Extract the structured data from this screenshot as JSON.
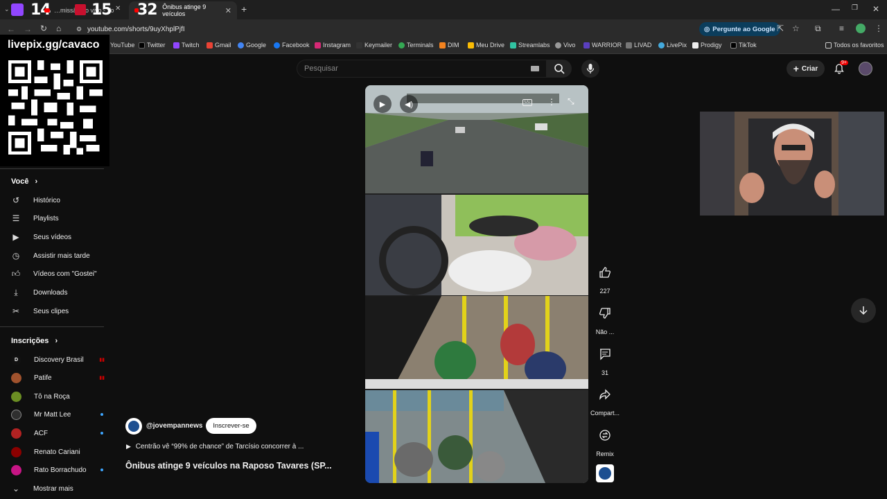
{
  "browser": {
    "tabs": [
      {
        "label": "…missão ao vivo - Yo",
        "counter": "14"
      },
      {
        "label": "",
        "counter": "15"
      },
      {
        "label": "Ônibus atinge 9 veículos",
        "counter": "32"
      }
    ],
    "new_tab": "+",
    "url": "youtube.com/shorts/9uyXhplPjfI",
    "ask_google": "Pergunte ao Google",
    "bookmarks": [
      "YouTube",
      "Twitter",
      "Twitch",
      "Gmail",
      "Google",
      "Facebook",
      "Instagram",
      "Keymailer",
      "Terminals",
      "DIM",
      "Meu Drive",
      "Streamlabs",
      "Vivo",
      "WARRIOR",
      "LIVAD",
      "LivePix",
      "Prodigy",
      "TikTok"
    ],
    "all_bookmarks": "Todos os favoritos"
  },
  "overlay": {
    "livepix": "livepix.gg/cavaco"
  },
  "sidebar": {
    "you_heading": "Você",
    "you_items": [
      {
        "label": "Histórico",
        "icon": "history-icon"
      },
      {
        "label": "Playlists",
        "icon": "playlist-icon"
      },
      {
        "label": "Seus vídeos",
        "icon": "your-videos-icon"
      },
      {
        "label": "Assistir mais tarde",
        "icon": "watch-later-icon"
      },
      {
        "label": "Vídeos com \"Gostei\"",
        "icon": "thumbs-up-icon"
      },
      {
        "label": "Downloads",
        "icon": "download-icon"
      },
      {
        "label": "Seus clipes",
        "icon": "scissors-icon"
      }
    ],
    "subs_heading": "Inscrições",
    "subscriptions": [
      {
        "label": "Discovery Brasil",
        "live": true,
        "color": "#111111",
        "initial": "D"
      },
      {
        "label": "Patife",
        "live": true,
        "color": "#a0522d",
        "initial": ""
      },
      {
        "label": "Tô na Roça",
        "live": false,
        "color": "#6b8e23",
        "initial": ""
      },
      {
        "label": "Mr Matt Lee",
        "live": false,
        "color": "#2f2f2f",
        "initial": ""
      },
      {
        "label": "ACF",
        "live": false,
        "color": "#b22222",
        "initial": ""
      },
      {
        "label": "Renato Cariani",
        "live": false,
        "color": "#8b0000",
        "initial": ""
      },
      {
        "label": "Rato Borrachudo",
        "live": false,
        "color": "#c71585",
        "initial": ""
      }
    ],
    "show_more": "Mostrar mais"
  },
  "header": {
    "search_placeholder": "Pesquisar",
    "create_label": "Criar",
    "notif_badge": "9+"
  },
  "short": {
    "likes": "227",
    "dislike_label": "Não ...",
    "comments": "31",
    "share_label": "Compart...",
    "remix_label": "Remix",
    "channel": "@jovempannews",
    "subscribe": "Inscrever-se",
    "related": "Centrão vê “99% de chance” de Tarcísio concorrer à ...",
    "title": "Ônibus atinge 9 veículos na Raposo Tavares (SP..."
  }
}
